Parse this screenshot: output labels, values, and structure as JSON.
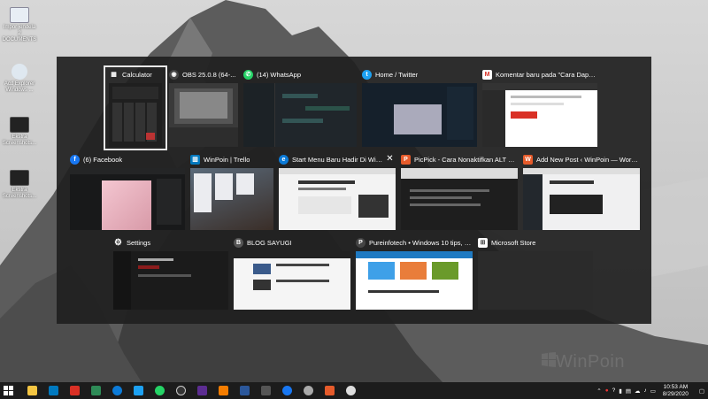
{
  "desktop": {
    "icons": [
      {
        "label": "Impor jendela 2 DOCUMENTS",
        "color": "#e8eef5"
      },
      {
        "label": "Acd Explorer Windows ...",
        "color": "#dfe8f0"
      },
      {
        "label": "Ekstra Screenshots...",
        "color": "#222"
      },
      {
        "label": "Ekstra Screenshots...",
        "color": "#222"
      }
    ]
  },
  "switcher": {
    "windows": [
      {
        "title": "Calculator",
        "icon": "calculator-icon",
        "color": "#2b2b2b",
        "glyph": "▦",
        "thumb": "#1f1f1f"
      },
      {
        "title": "OBS 25.0.8 (64-...",
        "icon": "obs-icon",
        "color": "#444",
        "glyph": "◉",
        "thumb": "#3a3a3a"
      },
      {
        "title": "(14) WhatsApp",
        "icon": "whatsapp-icon",
        "color": "#25d366",
        "glyph": "✆",
        "thumb": "#20262b"
      },
      {
        "title": "Home / Twitter",
        "icon": "twitter-icon",
        "color": "#1da1f2",
        "glyph": "t",
        "thumb": "#15202b"
      },
      {
        "title": "Komentar baru pada \"Cara Dapatk...",
        "icon": "gmail-icon",
        "color": "#d93025",
        "glyph": "M",
        "thumb": "#ffffff"
      },
      {
        "title": "(6) Facebook",
        "icon": "facebook-icon",
        "color": "#1877f2",
        "glyph": "f",
        "thumb": "#18191a"
      },
      {
        "title": "WinPoin | Trello",
        "icon": "trello-icon",
        "color": "#0079bf",
        "glyph": "▥",
        "thumb": "#0067a3"
      },
      {
        "title": "Start Menu Baru Hadir Di Windows...",
        "icon": "edge-icon",
        "color": "#0c7bd8",
        "glyph": "e",
        "thumb": "#f3f3f3"
      },
      {
        "title": "PicPick - Cara Nonaktifkan ALT + T...",
        "icon": "picpick-icon",
        "color": "#e65b2b",
        "glyph": "P",
        "thumb": "#1e1e1e"
      },
      {
        "title": "Add New Post ‹ WinPoin — WordP...",
        "icon": "wordpress-icon",
        "color": "#e65b2b",
        "glyph": "W",
        "thumb": "#f0f0f1"
      },
      {
        "title": "Settings",
        "icon": "settings-icon",
        "color": "transparent",
        "glyph": "⚙",
        "thumb": "#1b1b1b"
      },
      {
        "title": "BLOG SAYUGI",
        "icon": "blogger-icon",
        "color": "#555",
        "glyph": "B",
        "thumb": "#f5f5f5"
      },
      {
        "title": "Pureinfotech • Windows 10 tips, on...",
        "icon": "chrome-icon",
        "color": "#444",
        "glyph": "P",
        "thumb": "#ffffff"
      },
      {
        "title": "Microsoft Store",
        "icon": "store-icon",
        "color": "#444",
        "glyph": "⊞",
        "thumb": "#2b2b2b"
      }
    ],
    "close_glyph": "✕"
  },
  "taskbar": {
    "apps": [
      {
        "name": "file-explorer",
        "color": "#f4c542"
      },
      {
        "name": "trello",
        "color": "#0079bf"
      },
      {
        "name": "gmail",
        "color": "#d93025"
      },
      {
        "name": "solitaire",
        "color": "#2e8b57"
      },
      {
        "name": "edge",
        "color": "#0c7bd8"
      },
      {
        "name": "twitter",
        "color": "#1da1f2"
      },
      {
        "name": "whatsapp",
        "color": "#25d366"
      },
      {
        "name": "obs",
        "color": "#333"
      },
      {
        "name": "store",
        "color": "#5c2d91"
      },
      {
        "name": "blogger",
        "color": "#f57d00"
      },
      {
        "name": "word",
        "color": "#2b579a"
      },
      {
        "name": "calculator",
        "color": "#555"
      },
      {
        "name": "facebook",
        "color": "#1877f2"
      },
      {
        "name": "settings",
        "color": "#aaa"
      },
      {
        "name": "picpick",
        "color": "#e65b2b"
      },
      {
        "name": "github",
        "color": "#ddd"
      }
    ],
    "time": "10:53 AM",
    "date": "8/29/2020"
  },
  "watermark": "WinPoin"
}
